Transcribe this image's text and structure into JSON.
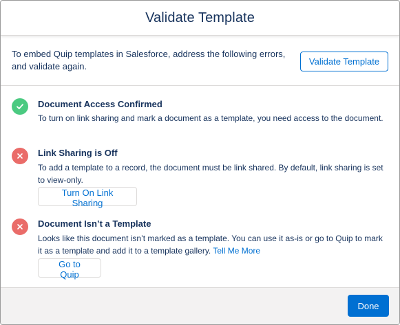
{
  "modal": {
    "title": "Validate Template"
  },
  "intro": {
    "text": "To embed Quip templates in Salesforce, address the following errors, and validate again.",
    "validate_button": "Validate Template"
  },
  "checks": [
    {
      "status": "success",
      "icon": "check-icon",
      "title": "Document Access Confirmed",
      "description": "To turn on link sharing and mark a document as a template, you need access to the document."
    },
    {
      "status": "error",
      "icon": "close-icon",
      "title": "Link Sharing is Off",
      "description": "To add a template to a record, the document must be link shared. By default, link sharing is set to view-only.",
      "action_label": "Turn On Link Sharing"
    },
    {
      "status": "error",
      "icon": "close-icon",
      "title": "Document Isn’t a Template",
      "description": "Looks like this document isn’t marked as a template. You can use it as-is or go to Quip to mark it as a template and add it to a template gallery.",
      "link_label": "Tell Me More",
      "action_label": "Go to Quip"
    }
  ],
  "footer": {
    "done_label": "Done"
  },
  "colors": {
    "brand": "#0070d2",
    "success": "#4bca81",
    "error": "#ea6c69",
    "text": "#16325c"
  }
}
